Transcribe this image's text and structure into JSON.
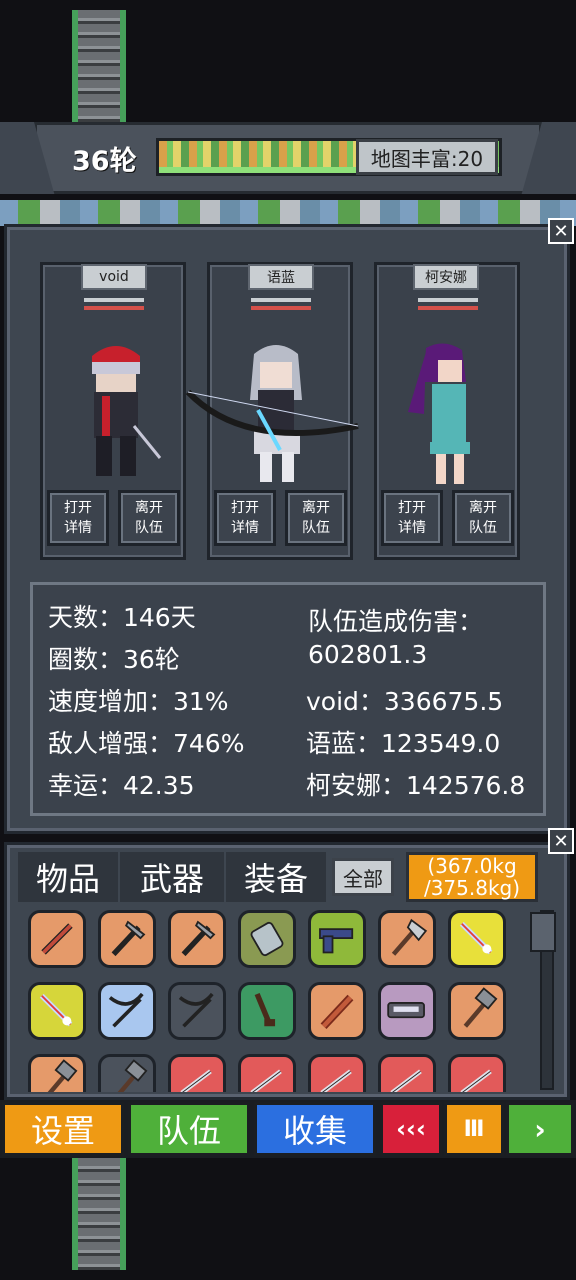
{
  "header": {
    "round": "36轮",
    "map_richness": "地图丰富:20"
  },
  "party": [
    {
      "name": "void",
      "open_label": "打开\n详情",
      "leave_label": "离开\n队伍"
    },
    {
      "name": "语蓝",
      "open_label": "打开\n详情",
      "leave_label": "离开\n队伍"
    },
    {
      "name": "柯安娜",
      "open_label": "打开\n详情",
      "leave_label": "离开\n队伍"
    }
  ],
  "stats": {
    "days": "天数：146天",
    "laps": "圈数：36轮",
    "speed": "速度增加：31%",
    "enemy": "敌人增强：746%",
    "luck": "幸运：42.35",
    "team_damage_label": "队伍造成伤害：",
    "team_damage_value": "602801.3",
    "dmg_void": "void：336675.5",
    "dmg_yulan": "语蓝：123549.0",
    "dmg_keanna": "柯安娜：142576.8"
  },
  "inventory": {
    "tabs": [
      "物品",
      "武器",
      "装备"
    ],
    "all_label": "全部",
    "weight_current": "(367.0kg",
    "weight_max": "/375.8kg)",
    "slots": [
      {
        "icon": "wrench-icon",
        "color": "#e59a6a"
      },
      {
        "icon": "pickaxe-icon",
        "color": "#e59a6a"
      },
      {
        "icon": "pickaxe-icon",
        "color": "#e59a6a"
      },
      {
        "icon": "grenade-icon",
        "color": "#8a9a52"
      },
      {
        "icon": "pistol-icon",
        "color": "#8fb93a"
      },
      {
        "icon": "axe-icon",
        "color": "#e59a6a"
      },
      {
        "icon": "magic-sword-icon",
        "color": "#e8e03a"
      },
      {
        "icon": "magic-sword-icon",
        "color": "#d6d63a"
      },
      {
        "icon": "crossbow-icon",
        "color": "#a9c7ef"
      },
      {
        "icon": "crossbow-icon",
        "color": "#4b525c"
      },
      {
        "icon": "rifle-icon",
        "color": "#3d9a63"
      },
      {
        "icon": "club-icon",
        "color": "#e59a6a"
      },
      {
        "icon": "shotgun-icon",
        "color": "#b89ac0"
      },
      {
        "icon": "hammer-icon",
        "color": "#e59a6a"
      },
      {
        "icon": "hammer-icon",
        "color": "#e59a6a"
      },
      {
        "icon": "hammer-icon",
        "color": "#4b525c"
      },
      {
        "icon": "blade-icon",
        "color": "#e25a5a"
      },
      {
        "icon": "blade-icon",
        "color": "#e25a5a"
      },
      {
        "icon": "blade-icon",
        "color": "#e25a5a"
      },
      {
        "icon": "blade-icon",
        "color": "#e25a5a"
      },
      {
        "icon": "blade-icon",
        "color": "#e25a5a"
      }
    ]
  },
  "menu": {
    "settings": "设置",
    "team": "队伍",
    "collect": "收集",
    "rewind": "‹‹‹",
    "pause": "Ⅲ",
    "play": "›"
  },
  "colors": {
    "settings": "#ef9a14",
    "team": "#4fb03a",
    "collect": "#2b6fe0",
    "rewind": "#d8203a",
    "pause": "#ef9a14",
    "play": "#4fb03a"
  }
}
